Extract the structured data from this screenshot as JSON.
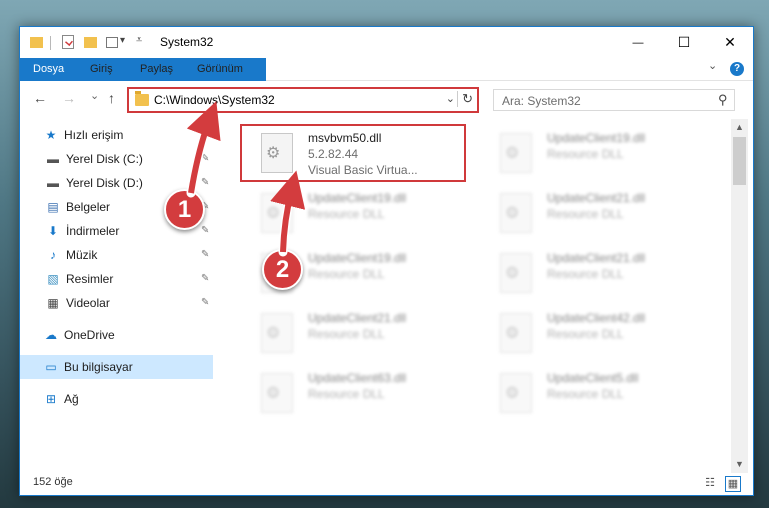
{
  "window": {
    "title": "System32",
    "quick_access_dropdown": "▾",
    "minimize": "—",
    "maximize": "☐",
    "close": "✕"
  },
  "ribbon": {
    "tabs": [
      "Dosya",
      "Giriş",
      "Paylaş",
      "Görünüm"
    ],
    "expand": "⌄",
    "help": "?"
  },
  "navigation": {
    "back": "←",
    "forward": "→",
    "recent": "⌄",
    "up": "↑",
    "address": "C:\\Windows\\System32",
    "address_dropdown": "⌄",
    "refresh": "↻",
    "search_placeholder": "Ara: System32"
  },
  "sidebar": {
    "items": [
      {
        "label": "Hızlı erişim",
        "icon": "star-icon",
        "glyph": "★",
        "color": "#1979ca"
      },
      {
        "label": "Yerel Disk (C:)",
        "icon": "drive-icon",
        "glyph": "▬",
        "color": "#555555",
        "pinned": true
      },
      {
        "label": "Yerel Disk (D:)",
        "icon": "drive-icon",
        "glyph": "▬",
        "color": "#555555",
        "pinned": true
      },
      {
        "label": "Belgeler",
        "icon": "document-icon",
        "glyph": "▤",
        "color": "#3a6fb0",
        "pinned": true
      },
      {
        "label": "İndirmeler",
        "icon": "download-icon",
        "glyph": "⬇",
        "color": "#1979ca",
        "pinned": true
      },
      {
        "label": "Müzik",
        "icon": "music-icon",
        "glyph": "♪",
        "color": "#1979ca",
        "pinned": true
      },
      {
        "label": "Resimler",
        "icon": "pictures-icon",
        "glyph": "▧",
        "color": "#3a8fc0",
        "pinned": true
      },
      {
        "label": "Videolar",
        "icon": "video-icon",
        "glyph": "▦",
        "color": "#444444",
        "pinned": true
      },
      {
        "label": "OneDrive",
        "icon": "cloud-icon",
        "glyph": "☁",
        "color": "#1979ca"
      },
      {
        "label": "Bu bilgisayar",
        "icon": "computer-icon",
        "glyph": "▭",
        "color": "#1979ca",
        "selected": true
      },
      {
        "label": "Ağ",
        "icon": "network-icon",
        "glyph": "⊞",
        "color": "#1979ca"
      }
    ],
    "pin_glyph": "✎"
  },
  "files": [
    {
      "name": "msvbvm50.dll",
      "version": "5.2.82.44",
      "description": "Visual Basic Virtua...",
      "highlighted": true
    },
    {
      "name": "UpdateClient19.dll",
      "type": "Resource DLL"
    },
    {
      "name": "UpdateClient19.dll",
      "type": "Resource DLL"
    },
    {
      "name": "UpdateClient21.dll",
      "type": "Resource DLL"
    },
    {
      "name": "UpdateClient19.dll",
      "type": "Resource DLL"
    },
    {
      "name": "UpdateClient21.dll",
      "type": "Resource DLL"
    },
    {
      "name": "UpdateClient21.dll",
      "type": "Resource DLL"
    },
    {
      "name": "UpdateClient42.dll",
      "type": "Resource DLL"
    },
    {
      "name": "UpdateClient63.dll",
      "type": "Resource DLL"
    },
    {
      "name": "UpdateClient5.dll",
      "type": "Resource DLL"
    }
  ],
  "status": {
    "item_count": "152 öğe"
  },
  "callouts": [
    "1",
    "2"
  ],
  "colors": {
    "accent": "#1979ca",
    "callout": "#d33c3e",
    "highlight_border": "#d0393b"
  }
}
